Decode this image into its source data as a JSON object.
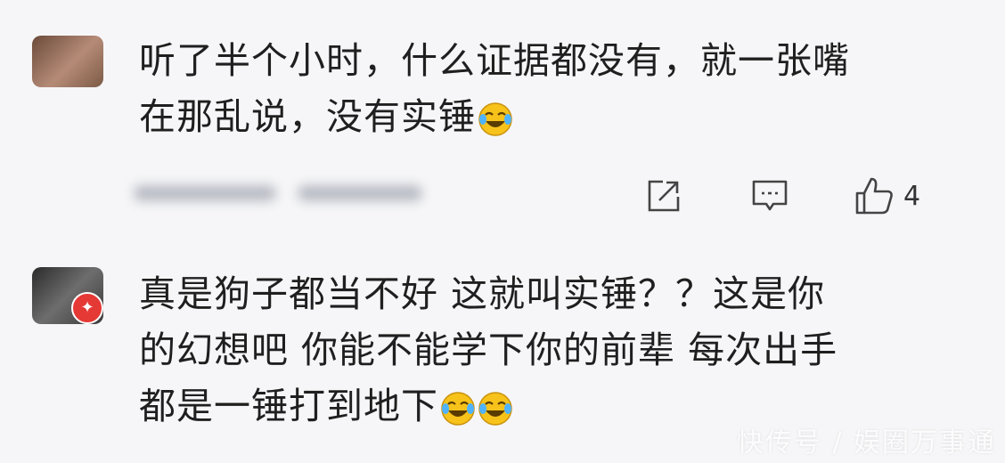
{
  "comments": [
    {
      "text": "听了半个小时，什么证据都没有，就一张嘴\n在那乱说，没有实锤",
      "emoji_count": 1,
      "like_count": "4"
    },
    {
      "text": "真是狗子都当不好 这就叫实锤？？这是你\n的幻想吧 你能不能学下你的前辈 每次出手\n都是一锤打到地下",
      "emoji_count": 2
    }
  ],
  "icons": {
    "share": "share-icon",
    "reply": "comment-icon",
    "like": "thumbs-up-icon",
    "emoji": "laugh-cry-emoji",
    "badge": "badge-icon"
  },
  "colors": {
    "background": "#f6f6f8",
    "text": "#1f1f1f",
    "badge": "#e53935",
    "emoji": "#f7c21a"
  },
  "watermark": "快传号 / 娱圈万事通"
}
